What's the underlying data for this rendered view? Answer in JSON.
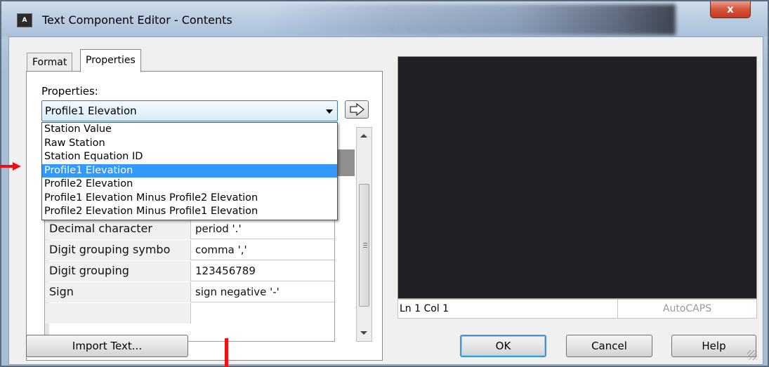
{
  "window": {
    "title": "Text Component Editor - Contents",
    "icon": "autocad-app-icon",
    "close_label": "x"
  },
  "tabs": [
    {
      "label": "Format"
    },
    {
      "label": "Properties",
      "active": true
    }
  ],
  "properties": {
    "label": "Properties:",
    "selected": "Profile1 Elevation",
    "options": [
      "Station Value",
      "Raw Station",
      "Station Equation ID",
      "Profile1 Elevation",
      "Profile2 Elevation",
      "Profile1 Elevation Minus Profile2 Elevation",
      "Profile2 Elevation Minus Profile1 Elevation"
    ],
    "insert_icon": "arrow-right-icon"
  },
  "grid_rows": [
    {
      "name": "Decimal character",
      "value": "period '.'"
    },
    {
      "name": "Digit grouping symbo",
      "value": "comma ','"
    },
    {
      "name": "Digit grouping",
      "value": "123456789"
    },
    {
      "name": "Sign",
      "value": "sign negative '-'"
    }
  ],
  "status": {
    "position": "Ln 1 Col 1",
    "caps": "AutoCAPS"
  },
  "buttons": {
    "import": "Import Text...",
    "ok": "OK",
    "cancel": "Cancel",
    "help": "Help"
  },
  "colors": {
    "selection": "#3399ff",
    "preview_bg": "#1e2023",
    "annotation_red": "#ee1111",
    "close_button": "#c94028"
  }
}
